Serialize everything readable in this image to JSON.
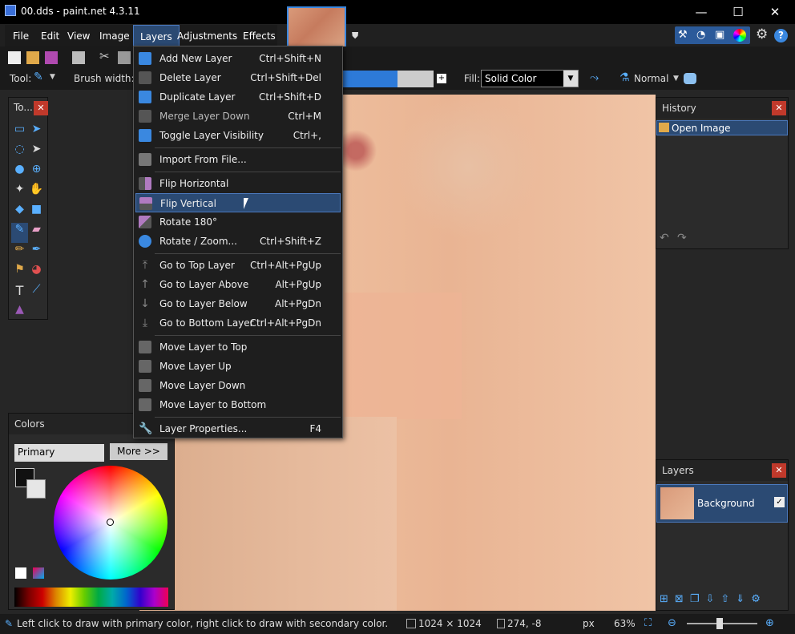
{
  "window": {
    "title": "00.dds - paint.net 4.3.11",
    "minimize": "—",
    "maximize": "☐",
    "close": "✕"
  },
  "menu": [
    "File",
    "Edit",
    "View",
    "Image",
    "Layers",
    "Adjustments",
    "Effects"
  ],
  "toolbar": {
    "tool_label": "Tool:",
    "brush_label": "Brush width:",
    "fill_label": "Fill:",
    "fill_value": "Solid Color",
    "blend_value": "Normal"
  },
  "tools_panel": {
    "title": "To..."
  },
  "colors_panel": {
    "title": "Colors",
    "select_value": "Primary",
    "more": "More >>"
  },
  "history_panel": {
    "title": "History",
    "items": [
      "Open Image"
    ]
  },
  "layers_panel": {
    "title": "Layers",
    "layers": [
      "Background"
    ]
  },
  "layers_menu": [
    {
      "label": "Add New Layer",
      "shortcut": "Ctrl+Shift+N"
    },
    {
      "label": "Delete Layer",
      "shortcut": "Ctrl+Shift+Del"
    },
    {
      "label": "Duplicate Layer",
      "shortcut": "Ctrl+Shift+D"
    },
    {
      "label": "Merge Layer Down",
      "shortcut": "Ctrl+M"
    },
    {
      "label": "Toggle Layer Visibility",
      "shortcut": "Ctrl+,"
    },
    {
      "label": "Import From File...",
      "shortcut": ""
    },
    {
      "label": "Flip Horizontal",
      "shortcut": ""
    },
    {
      "label": "Flip Vertical",
      "shortcut": ""
    },
    {
      "label": "Rotate 180°",
      "shortcut": ""
    },
    {
      "label": "Rotate / Zoom...",
      "shortcut": "Ctrl+Shift+Z"
    },
    {
      "label": "Go to Top Layer",
      "shortcut": "Ctrl+Alt+PgUp"
    },
    {
      "label": "Go to Layer Above",
      "shortcut": "Alt+PgUp"
    },
    {
      "label": "Go to Layer Below",
      "shortcut": "Alt+PgDn"
    },
    {
      "label": "Go to Bottom Layer",
      "shortcut": "Ctrl+Alt+PgDn"
    },
    {
      "label": "Move Layer to Top",
      "shortcut": ""
    },
    {
      "label": "Move Layer Up",
      "shortcut": ""
    },
    {
      "label": "Move Layer Down",
      "shortcut": ""
    },
    {
      "label": "Move Layer to Bottom",
      "shortcut": ""
    },
    {
      "label": "Layer Properties...",
      "shortcut": "F4"
    }
  ],
  "status": {
    "hint": "Left click to draw with primary color, right click to draw with secondary color.",
    "image_size": "1024 × 1024",
    "cursor": "274, -8",
    "units": "px",
    "zoom": "63%"
  },
  "accent": "#2b4a73"
}
